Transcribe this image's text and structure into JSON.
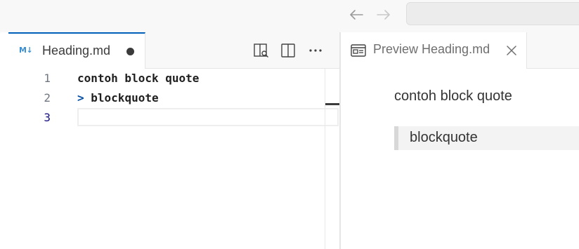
{
  "titlebar": {
    "back_icon": "arrow-left-icon",
    "forward_icon": "arrow-right-icon",
    "search_placeholder": ""
  },
  "editor_left": {
    "tab": {
      "icon": "markdown-icon",
      "icon_text": "M↓",
      "label": "Heading.md",
      "dirty": true
    },
    "actions": [
      {
        "name": "open-preview-to-side",
        "icon": "preview-side-icon"
      },
      {
        "name": "split-editor",
        "icon": "split-editor-icon"
      },
      {
        "name": "more-actions",
        "icon": "ellipsis-icon"
      }
    ],
    "lines": [
      {
        "number": "1",
        "text": "contoh block quote"
      },
      {
        "number": "2",
        "marker": ">",
        "text": " blockquote"
      },
      {
        "number": "3",
        "text": ""
      }
    ],
    "current_line": 3
  },
  "editor_right": {
    "tab": {
      "icon": "preview-icon",
      "label": "Preview Heading.md",
      "close_icon": "close-icon"
    },
    "preview": {
      "paragraph": "contoh block quote",
      "blockquote": "blockquote"
    }
  },
  "colors": {
    "accent": "#005fb8",
    "markdown_icon": "#3a8fd4",
    "quote_marker": "#0451a5",
    "current_line_number": "#171184"
  }
}
